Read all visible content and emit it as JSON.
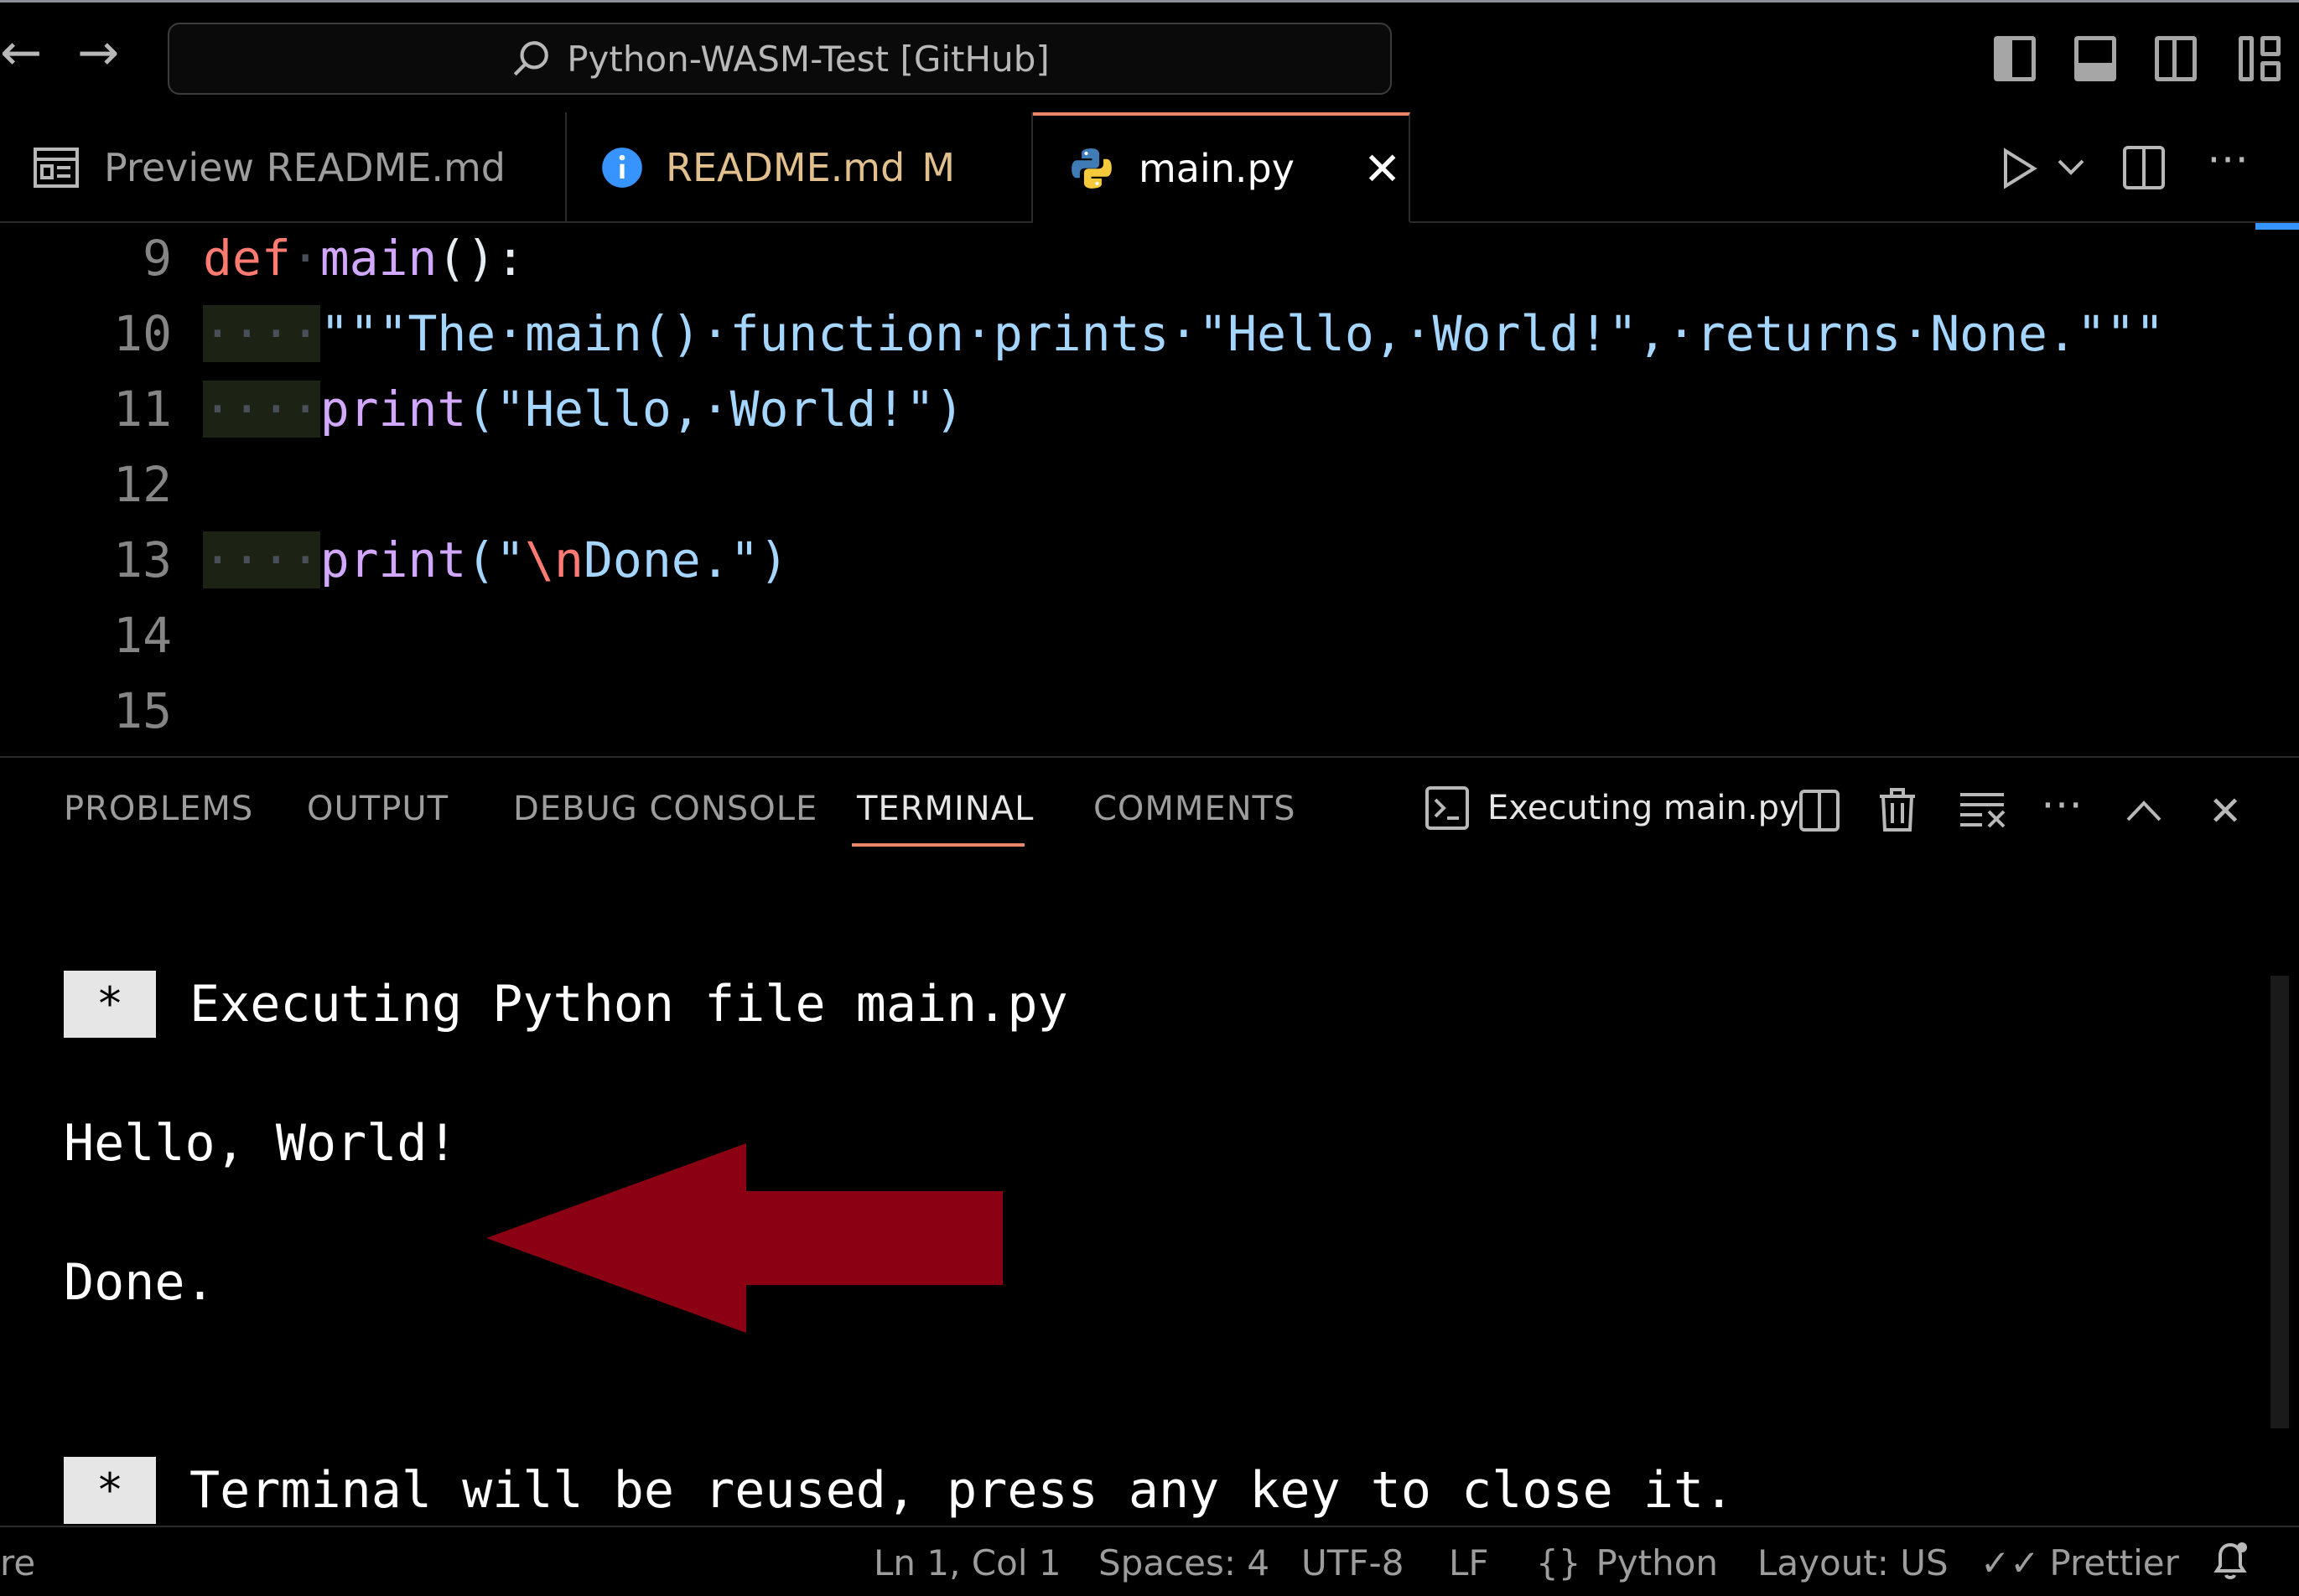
{
  "titlebar": {
    "command_center": "Python-WASM-Test [GitHub]"
  },
  "tabs": [
    {
      "label": "Preview README.md",
      "icon": "preview-icon"
    },
    {
      "label": "README.md",
      "badge": "M",
      "icon": "info-icon"
    },
    {
      "label": "main.py",
      "icon": "python-icon",
      "active": true
    }
  ],
  "editor": {
    "line_numbers": [
      "9",
      "10",
      "11",
      "12",
      "13",
      "14",
      "15"
    ],
    "lines": {
      "l9_kw": "def",
      "l9_fn": "main",
      "l9_rest": "():",
      "l10_str": "\"\"\"The·main()·function·prints·\"Hello,·World!\",·returns·None.\"\"\"",
      "l11_fn": "print",
      "l11_p1": "(",
      "l11_str": "\"Hello,·World!\"",
      "l11_p2": ")",
      "l13_fn": "print",
      "l13_p1": "(",
      "l13_q1": "\"",
      "l13_esc": "\\n",
      "l13_str": "Done.\"",
      "l13_p2": ")",
      "indent_dots": "····"
    }
  },
  "panel": {
    "tabs": [
      "PROBLEMS",
      "OUTPUT",
      "DEBUG CONSOLE",
      "TERMINAL",
      "COMMENTS"
    ],
    "active_tab": "TERMINAL",
    "terminal_name": "Executing main.py",
    "terminal_lines": {
      "star": "*",
      "exec": "Executing Python file main.py",
      "hello": "Hello, World!",
      "done": "Done.",
      "reuse": "Terminal will be reused, press any key to close it."
    }
  },
  "statusbar": {
    "left_fragment": "re",
    "position": "Ln 1, Col 1",
    "spaces": "Spaces: 4",
    "encoding": "UTF-8",
    "eol": "LF",
    "language": "Python",
    "layout": "Layout: US",
    "formatter": "Prettier"
  },
  "colors": {
    "active_tab_border": "#e8876a",
    "arrow_annotation": "#8b0013",
    "readme_modified": "#e2c08d"
  }
}
